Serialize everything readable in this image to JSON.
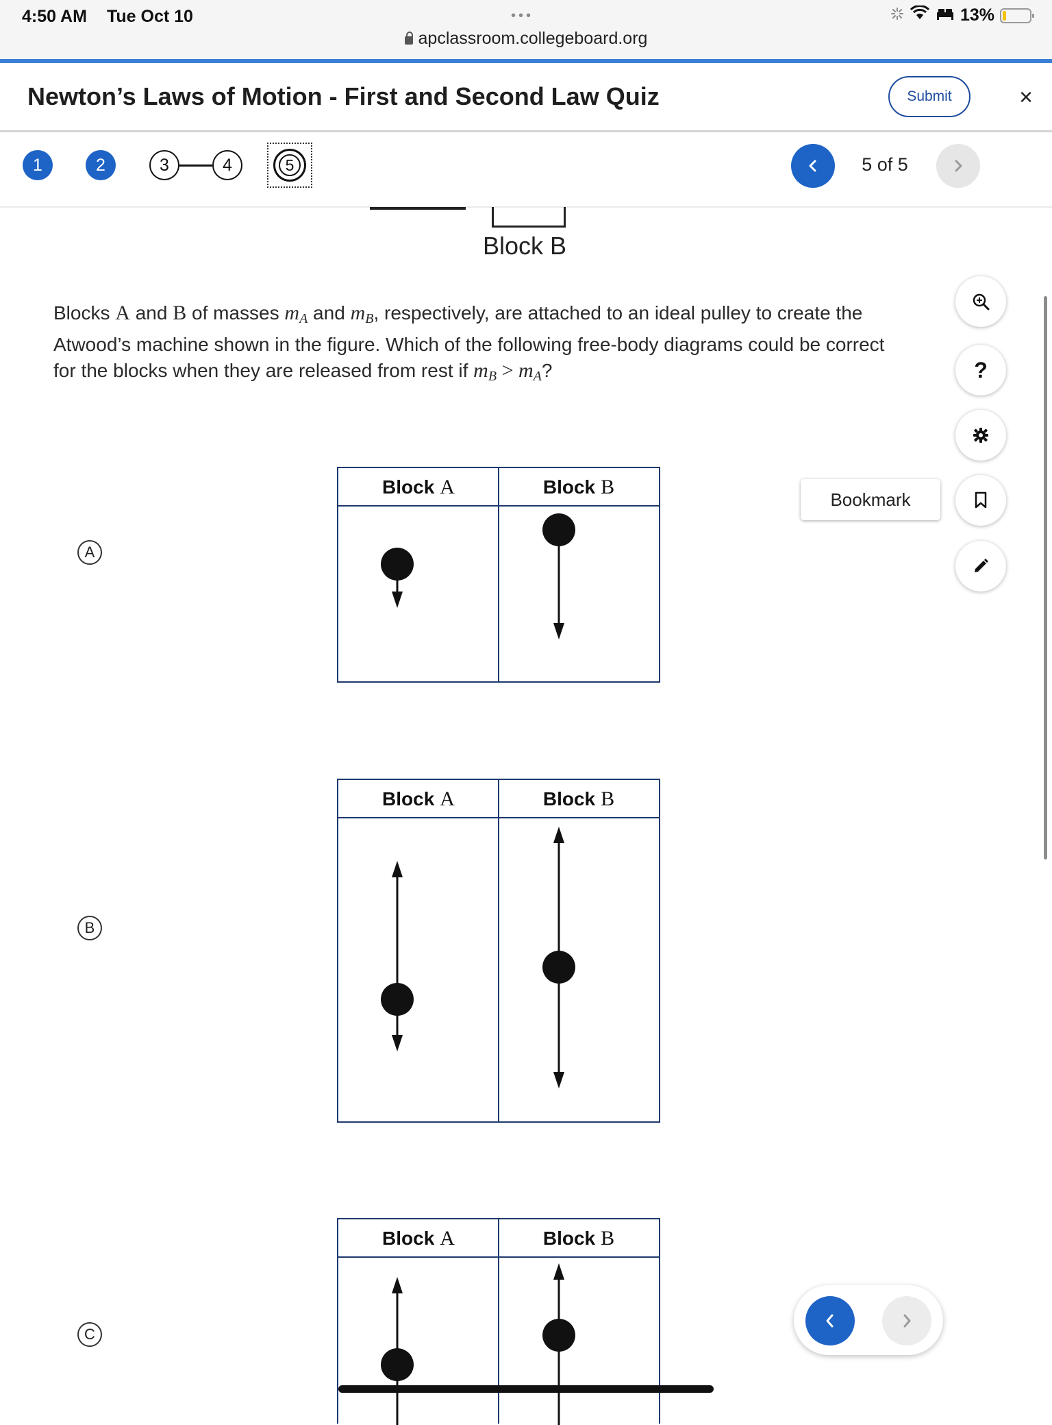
{
  "status_bar": {
    "time": "4:50 AM",
    "date": "Tue Oct 10",
    "tab_dots": "•••",
    "url": "apclassroom.collegeboard.org",
    "battery_text": "13%",
    "battery_level": 0.13
  },
  "header": {
    "title": "Newton’s Laws of Motion - First and Second Law Quiz",
    "submit_label": "Submit",
    "close_symbol": "×"
  },
  "question_nav": {
    "questions": [
      {
        "number": "1",
        "state": "answered"
      },
      {
        "number": "2",
        "state": "answered"
      },
      {
        "number": "3",
        "state": "unanswered"
      },
      {
        "number": "4",
        "state": "unanswered"
      },
      {
        "number": "5",
        "state": "current"
      }
    ],
    "counter": "5 of 5"
  },
  "question": {
    "figure_label": "Block B",
    "text_1": "Blocks ",
    "A": "A",
    "text_2": " and ",
    "B": "B",
    "text_3": " of masses ",
    "m": "m",
    "sub_A": "A",
    "text_4": " and ",
    "sub_B": "B",
    "text_5": ", respectively, are attached to an ideal pulley to create the Atwood’s machine shown in the figure. Which of the following free-body diagrams could be correct for the blocks when they are released from rest if ",
    "gt": " > ",
    "text_6": "?"
  },
  "options": [
    {
      "letter": "A",
      "header_word": "Block",
      "left_letter": "A",
      "right_letter": "B",
      "block_a": {
        "up": null,
        "down": "short"
      },
      "block_b": {
        "up": null,
        "down": "long"
      }
    },
    {
      "letter": "B",
      "header_word": "Block",
      "left_letter": "A",
      "right_letter": "B",
      "block_a": {
        "up": "long",
        "down": "short"
      },
      "block_b": {
        "up": "long",
        "down": "long"
      }
    },
    {
      "letter": "C",
      "header_word": "Block",
      "left_letter": "A",
      "right_letter": "B",
      "block_a": {
        "up": "short",
        "down": null
      },
      "block_b": {
        "up": "short",
        "down": null
      }
    }
  ],
  "tools": {
    "bookmark_label": "Bookmark",
    "help_symbol": "?",
    "icons": [
      "zoom-in-icon",
      "help-icon",
      "settings-icon",
      "bookmark-icon",
      "pencil-icon"
    ]
  },
  "colors": {
    "accent": "#1e63c6",
    "table_border": "#1d3a6e",
    "status_line": "#3c7fd6"
  }
}
